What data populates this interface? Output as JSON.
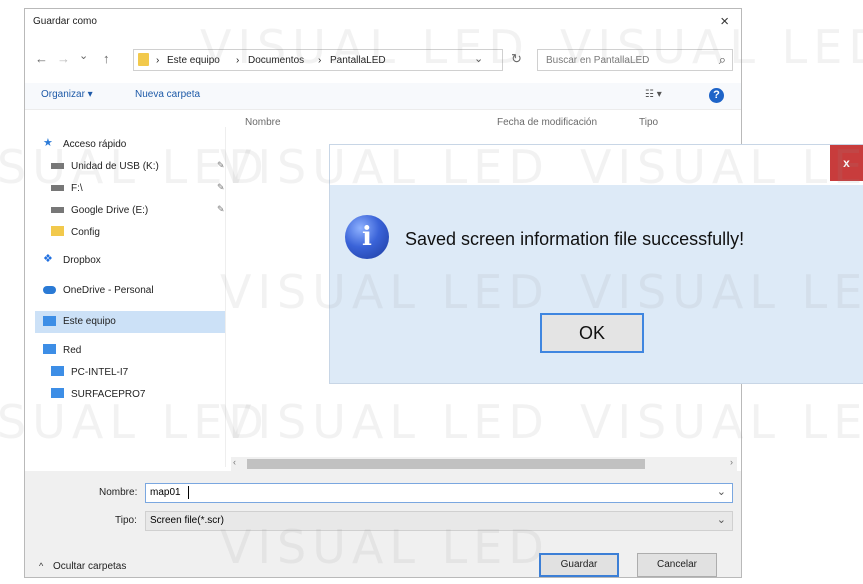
{
  "save_dialog": {
    "title": "Guardar como",
    "close_glyph": "×",
    "nav": {
      "back": "←",
      "forward": "→",
      "dropdown": "⌄",
      "up": "↑",
      "refresh": "↻",
      "search_icon": "⌕"
    },
    "breadcrumb": [
      "Este equipo",
      "Documentos",
      "PantallaLED"
    ],
    "breadcrumb_sep": "›",
    "search_placeholder": "Buscar en PantallaLED",
    "toolbar": {
      "organize": "Organizar ▾",
      "new_folder": "Nueva carpeta",
      "view": "☷ ▾",
      "help": "?"
    },
    "columns": {
      "name": "Nombre",
      "modified": "Fecha de modificación",
      "type": "Tipo"
    },
    "sidebar": [
      {
        "label": "Acceso rápido",
        "icon": "star-icon",
        "pinned": false
      },
      {
        "label": "Unidad de USB (K:)",
        "icon": "usb-drive-icon",
        "pinned": true
      },
      {
        "label": "F:\\",
        "icon": "drive-icon",
        "pinned": true
      },
      {
        "label": "Google Drive (E:)",
        "icon": "drive-icon",
        "pinned": true
      },
      {
        "label": "Config",
        "icon": "folder-icon",
        "pinned": false
      },
      {
        "label": "Dropbox",
        "icon": "dropbox-icon",
        "pinned": false
      },
      {
        "label": "OneDrive - Personal",
        "icon": "cloud-icon",
        "pinned": false
      },
      {
        "label": "Este equipo",
        "icon": "computer-icon",
        "pinned": false,
        "selected": true
      },
      {
        "label": "Red",
        "icon": "network-icon",
        "pinned": false
      },
      {
        "label": "PC-INTEL-I7",
        "icon": "computer-icon",
        "pinned": false
      },
      {
        "label": "SURFACEPRO7",
        "icon": "computer-icon",
        "pinned": false
      }
    ],
    "pin_glyph": "✎",
    "filename_label": "Nombre:",
    "filename_value": "map01",
    "filetype_label": "Tipo:",
    "filetype_value": "Screen file(*.scr)",
    "hide_folders": "Ocultar carpetas",
    "save_button": "Guardar",
    "cancel_button": "Cancelar"
  },
  "message_box": {
    "close_glyph": "x",
    "info_glyph": "i",
    "message": "Saved screen information file successfully!",
    "ok_label": "OK"
  },
  "watermark": "VISUAL LED",
  "colors": {
    "accent": "#3c7fd6",
    "close_red": "#c83c3c",
    "msg_bg": "#ddeaf7",
    "selected": "#cce1f7"
  }
}
